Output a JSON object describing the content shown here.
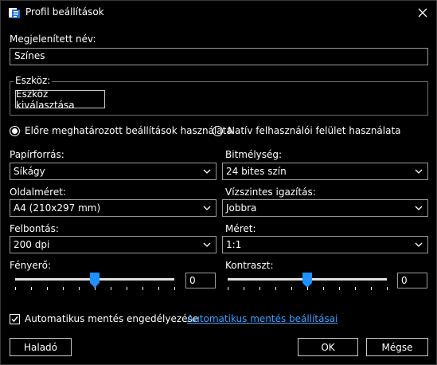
{
  "title": "Profil beállítások",
  "display_name": {
    "label": "Megjelenített név:",
    "value": "Színes"
  },
  "device": {
    "group_label": "Eszköz:",
    "select_button": "Eszköz kiválasztása"
  },
  "mode": {
    "option_preset": "Előre meghatározott beállítások használata",
    "option_native": "Natív felhasználói felület használata",
    "selected": "preset"
  },
  "paper_source": {
    "label": "Papírforrás:",
    "value": "Síkágy"
  },
  "bit_depth": {
    "label": "Bitmélység:",
    "value": "24 bites szín"
  },
  "page_size": {
    "label": "Oldalméret:",
    "value": "A4 (210x297 mm)"
  },
  "horizontal_align": {
    "label": "Vízszintes igazítás:",
    "value": "Jobbra"
  },
  "resolution": {
    "label": "Felbontás:",
    "value": "200 dpi"
  },
  "size": {
    "label": "Méret:",
    "value": "1:1"
  },
  "brightness": {
    "label": "Fényerő:",
    "value": "0",
    "level_fraction": 0.5
  },
  "contrast": {
    "label": "Kontraszt:",
    "value": "0",
    "level_fraction": 0.5
  },
  "autosave": {
    "label": "Automatikus mentés engedélyezése",
    "checked": true,
    "settings_link": "Automatikus mentés beállításai"
  },
  "buttons": {
    "advanced": "Haladó",
    "ok": "OK",
    "cancel": "Mégse"
  },
  "colors": {
    "accent": "#1e90ff",
    "link": "#3aa0ff",
    "background": "#000000"
  }
}
